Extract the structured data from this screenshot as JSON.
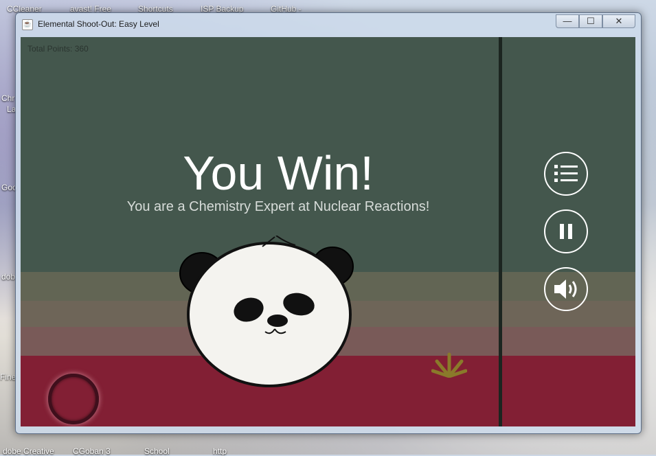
{
  "desktop": {
    "top_icons": [
      {
        "label": "CCleaner"
      },
      {
        "label": "avast! Free"
      },
      {
        "label": "Shortcuts"
      },
      {
        "label": "ISP Backup"
      },
      {
        "label": "GitHub -"
      }
    ],
    "left_icons": [
      {
        "label": "Chr"
      },
      {
        "label": "La"
      },
      {
        "label": "Goo"
      },
      {
        "label": "dob"
      },
      {
        "label": "Fine"
      }
    ],
    "bottom_icons": [
      {
        "label": "dobe Creative"
      },
      {
        "label": "CGoban 3"
      },
      {
        "label": "School"
      },
      {
        "label": "http"
      }
    ]
  },
  "window": {
    "title": "Elemental Shoot-Out: Easy Level",
    "controls": {
      "minimize": "—",
      "maximize": "☐",
      "close": "✕"
    }
  },
  "game": {
    "total_points_label": "Total Points: 360",
    "result_title": "You Win!",
    "result_subtitle": "You are a Chemistry Expert at Nuclear Reactions!",
    "side_buttons": [
      {
        "name": "menu",
        "icon": "list-icon"
      },
      {
        "name": "pause",
        "icon": "pause-icon"
      },
      {
        "name": "sound",
        "icon": "speaker-icon"
      }
    ],
    "colors": {
      "background": "#44574d",
      "band_dark_red": "#821f34",
      "leaf": "#8a7a2a"
    }
  }
}
